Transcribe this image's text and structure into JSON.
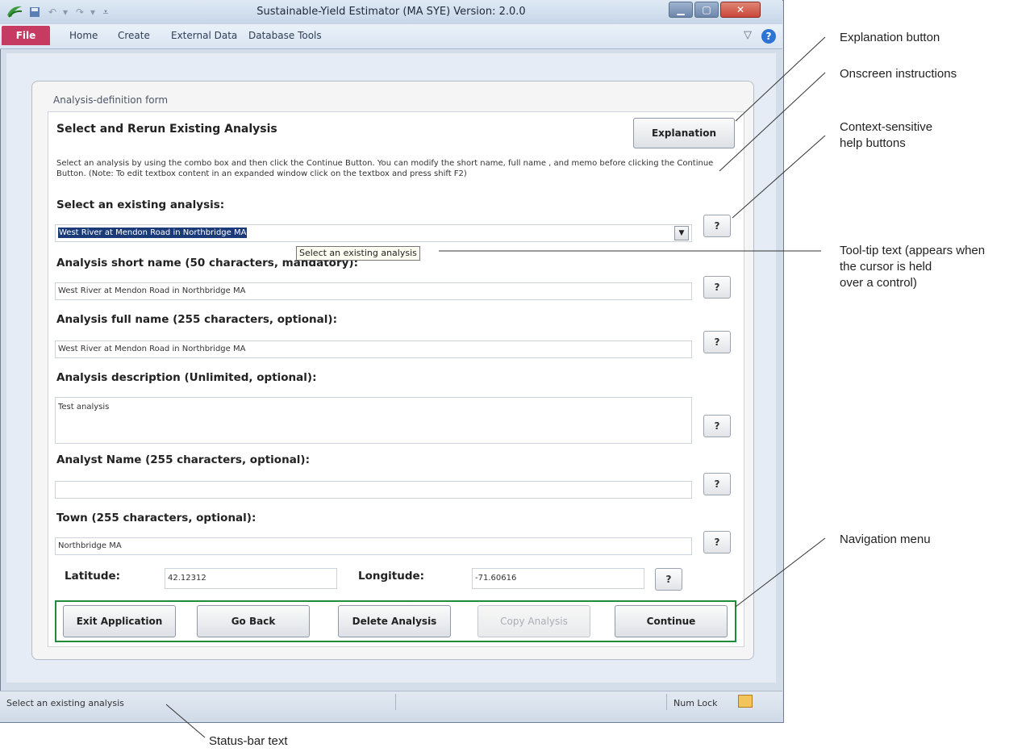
{
  "window": {
    "title": "Sustainable-Yield Estimator (MA SYE) Version: 2.0.0",
    "quick_access": [
      "save-icon",
      "undo-icon",
      "redo-icon",
      "customize-icon"
    ],
    "controls": [
      "minimize-icon",
      "maximize-icon",
      "close-icon"
    ]
  },
  "ribbon": {
    "tabs": [
      "File",
      "Home",
      "Create",
      "External Data",
      "Database Tools"
    ],
    "file_color": "#c63b62"
  },
  "form": {
    "title": "Analysis-definition form",
    "heading": "Select and Rerun Existing Analysis",
    "explanation_button": "Explanation",
    "instructions": "Select an analysis by using the combo box and then click the Continue Button. You can modify the short name, full name , and memo before clicking the Continue Button. (Note: To edit textbox content in an expanded window click on the textbox and press shift F2)",
    "help_label": "?",
    "fields": {
      "existing": {
        "label": "Select an existing analysis:",
        "value": "West River at Mendon Road in Northbridge MA"
      },
      "short_name": {
        "label": "Analysis short name (50 characters, mandatory):",
        "value": "West River at Mendon Road in Northbridge MA"
      },
      "full_name": {
        "label": "Analysis full name (255 characters, optional):",
        "value": "West River at Mendon Road in Northbridge MA"
      },
      "description": {
        "label": "Analysis description (Unlimited, optional):",
        "value": "Test analysis"
      },
      "analyst": {
        "label": "Analyst Name  (255 characters, optional):",
        "value": ""
      },
      "town": {
        "label": "Town (255 characters, optional):",
        "value": "Northbridge MA"
      },
      "latitude": {
        "label": "Latitude:",
        "value": "42.12312"
      },
      "longitude": {
        "label": "Longitude:",
        "value": "-71.60616"
      }
    },
    "tooltip": "Select an existing analysis",
    "nav": {
      "exit": "Exit Application",
      "back": "Go Back",
      "delete": "Delete Analysis",
      "copy": "Copy Analysis",
      "continue": "Continue"
    }
  },
  "statusbar": {
    "text": "Select an existing analysis",
    "numlock": "Num Lock"
  },
  "callouts": {
    "explanation": "Explanation button",
    "instructions": "Onscreen instructions",
    "help_line1": "Context-sensitive",
    "help_line2": "help buttons",
    "tooltip_line1": "Tool-tip text (appears when",
    "tooltip_line2": "the cursor is held",
    "tooltip_line3": "over a control)",
    "navigation": "Navigation menu",
    "status": "Status-bar text"
  },
  "colors": {
    "nav_border": "#1f8c3a",
    "file_tab": "#c63b62",
    "close_button": "#c9473a"
  }
}
